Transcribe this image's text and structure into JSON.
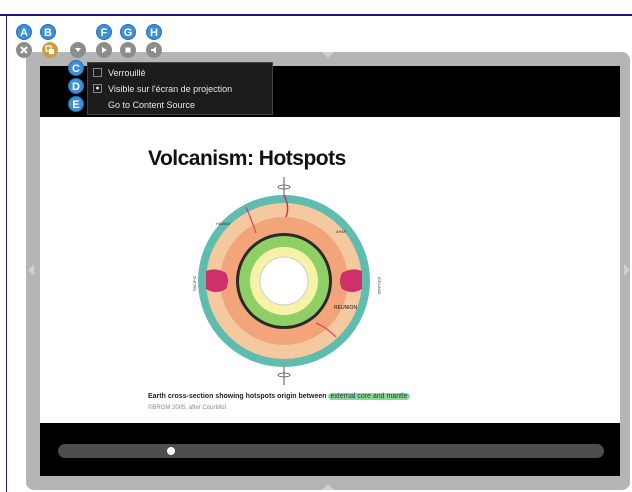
{
  "callouts": {
    "a": "A",
    "b": "B",
    "c": "C",
    "d": "D",
    "e": "E",
    "f": "F",
    "g": "G",
    "h": "H"
  },
  "toolbar": {
    "icons": [
      "close-icon",
      "copy-icon",
      "chevron-down-icon",
      "play-icon",
      "stop-icon",
      "speaker-icon"
    ]
  },
  "menu": {
    "items": [
      {
        "label": "Verrouillé",
        "checked": false
      },
      {
        "label": "Visible sur l'écran de projection",
        "checked": true
      },
      {
        "label": "Go to Content Source",
        "checked": false
      }
    ]
  },
  "slide": {
    "title": "Volcanism: Hotspots",
    "caption": "Earth cross-section showing hotspots origin between",
    "caption_highlight": "external core and mantle",
    "credit": "©BRGM 2005, after Courtillot",
    "diagram_labels": {
      "reunion": "REUNION",
      "pacific": "PACIFIC",
      "afar": "AFAR",
      "iceland": "ICELAND",
      "hawaii": "HAWAII"
    }
  },
  "playback": {
    "progress": 0.2
  },
  "colors": {
    "accent": "#3d8fd8",
    "highlight": "#8fd88f",
    "frame": "#b5b5b5"
  }
}
